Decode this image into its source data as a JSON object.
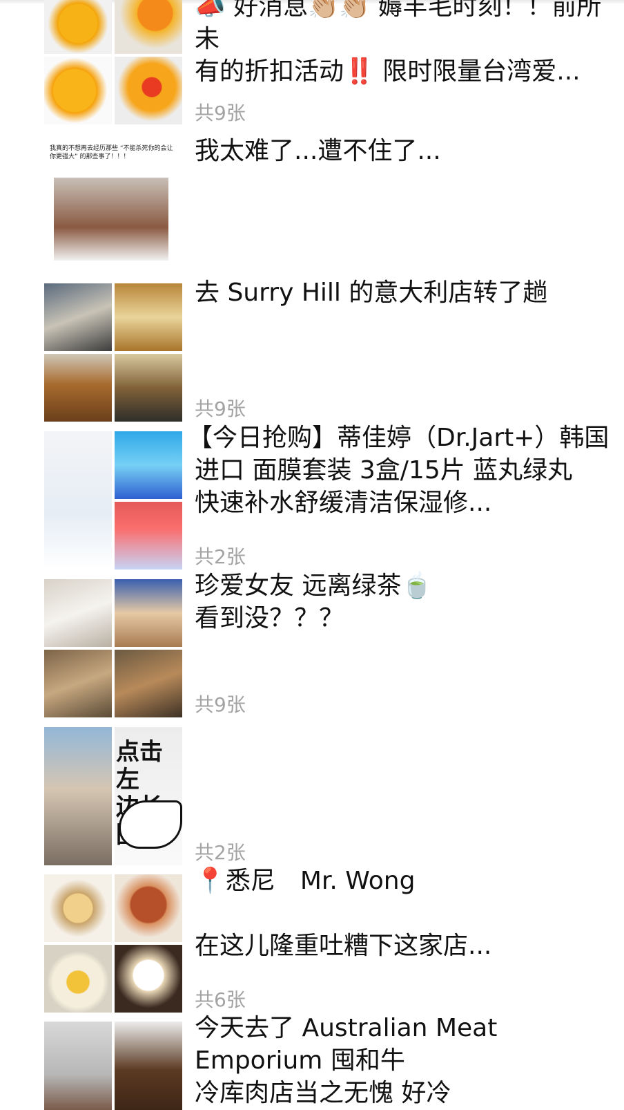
{
  "posts": [
    {
      "text_lines": [
        "📣 好消息👏🏼👏🏼 薅羊毛时刻！！前所未",
        "有的折扣活动‼️ 限时限量台湾爱..."
      ],
      "count": "共9张",
      "thumbs": [
        "mango-photo",
        "mango-photo",
        "mango-photo",
        "mango-photo"
      ]
    },
    {
      "text_lines": [
        "我太难了...遭不住了..."
      ],
      "count": "",
      "meme_caption": "我真的不想再去经历那些 “不能杀死你的会让你更强大” 的那些事了！！！"
    },
    {
      "text_lines": [
        "去 Surry Hill 的意大利店转了趟"
      ],
      "count": "共9张"
    },
    {
      "text_lines": [
        "【今日抢购】蒂佳婷（Dr.Jart+）韩国",
        "进口 面膜套装 3盒/15片 蓝丸绿丸",
        "快速补水舒缓清洁保湿修..."
      ],
      "count": "共2张"
    },
    {
      "text_lines": [
        "珍爱女友 远离绿茶🍵",
        "看到没？？？"
      ],
      "count": "共9张"
    },
    {
      "text_lines": [],
      "count": "共2张",
      "overlay_chars": "点击左\n边长图"
    },
    {
      "text_lines": [
        "📍悉尼　Mr. Wong",
        "",
        "在这儿隆重吐糟下这家店..."
      ],
      "count": "共6张"
    },
    {
      "text_lines": [
        "今天去了 Australian Meat",
        "Emporium 囤和牛",
        "冷库肉店当之无愧 好冷"
      ],
      "count": ""
    }
  ]
}
